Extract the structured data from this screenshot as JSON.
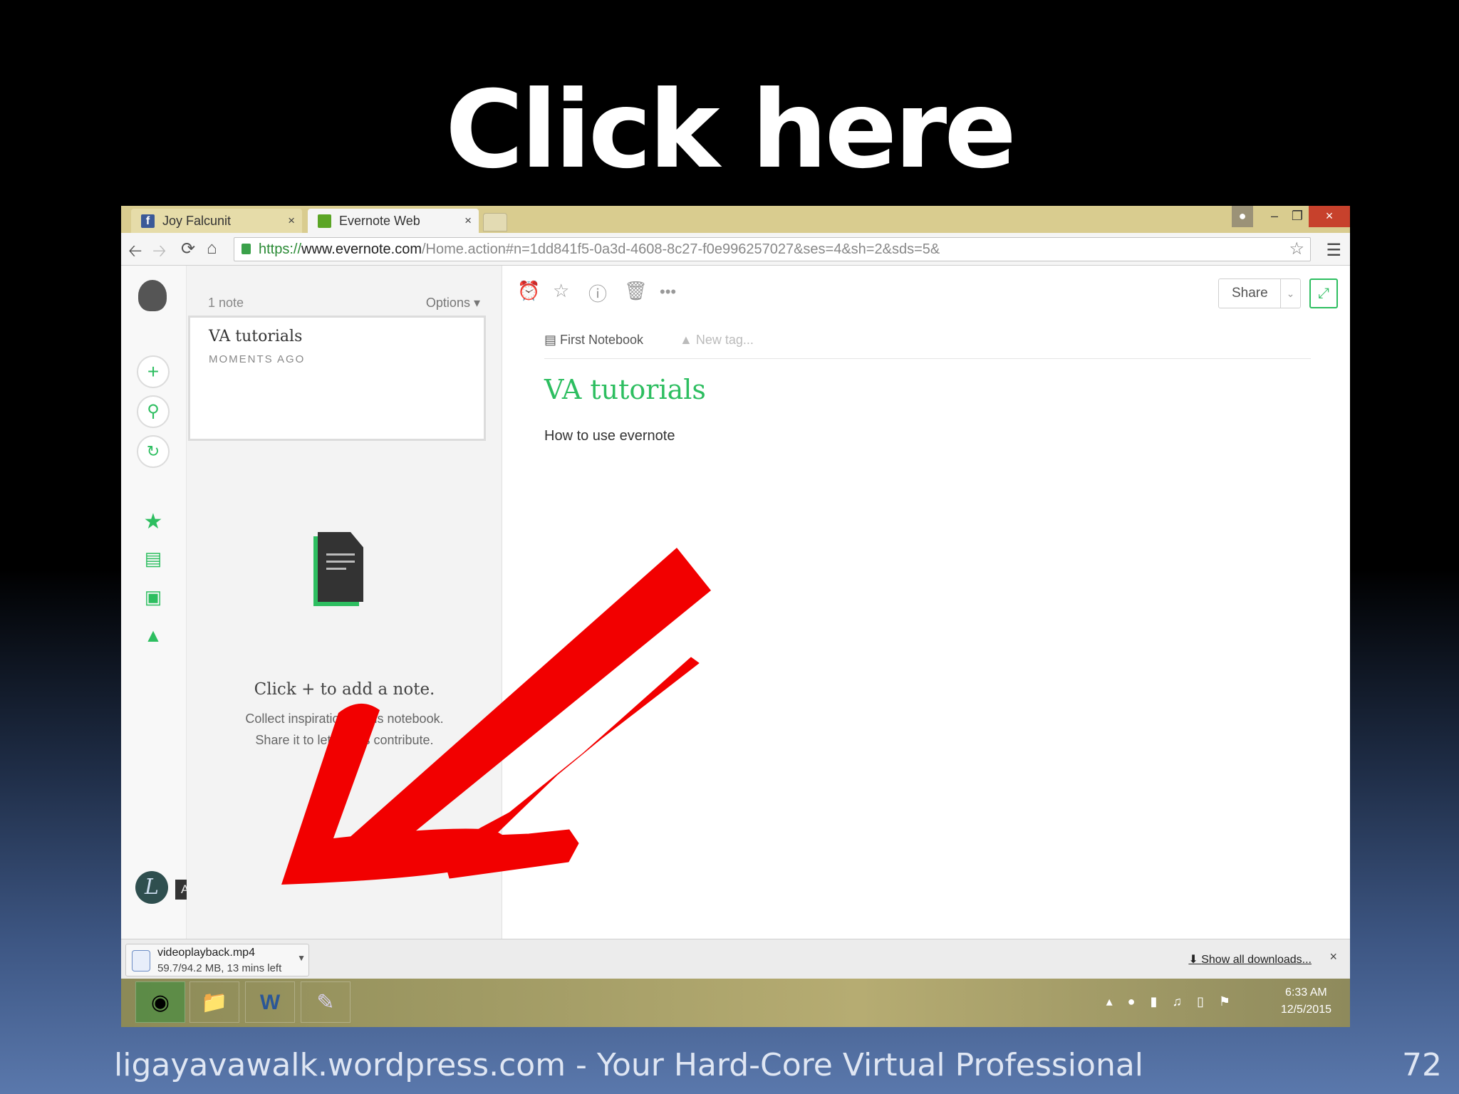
{
  "slide": {
    "title": "Click here",
    "footer": "ligayavawalk.wordpress.com - Your Hard-Core Virtual Professional",
    "page_number": "72"
  },
  "browser": {
    "tabs": [
      {
        "label": "Joy Falcunit",
        "favicon": "facebook-icon",
        "close": "×"
      },
      {
        "label": "Evernote Web",
        "favicon": "evernote-icon",
        "close": "×"
      }
    ],
    "address": {
      "scheme": "https://",
      "domain": "www.evernote.com",
      "path": "/Home.action#n=1dd841f5-0a3d-4608-8c27-f0e996257027&ses=4&sh=2&sds=5&"
    },
    "window_close": "×"
  },
  "evernote": {
    "note_count": "1 note",
    "options_label": "Options ▾",
    "note_card": {
      "title": "VA tutorials",
      "time": "MOMENTS AGO"
    },
    "empty_state": {
      "title": "Click + to add a note.",
      "line1": "Collect inspiration in this notebook.",
      "line2": "Share it to let others contribute."
    },
    "account_tooltip": "ACCOUNT",
    "editor": {
      "share_label": "Share",
      "notebook": "First Notebook",
      "new_tag_placeholder": "New tag...",
      "title": "VA tutorials",
      "body": "How to use evernote"
    },
    "accent_color": "#2dbe60"
  },
  "downloads": {
    "file_name": "videoplayback.mp4",
    "status": "59.7/94.2 MB, 13 mins left",
    "show_all": "Show all downloads...",
    "close": "×"
  },
  "taskbar": {
    "apps": [
      "chrome-icon",
      "file-explorer-icon",
      "word-icon",
      "paint-icon"
    ],
    "time": "6:33 AM",
    "date": "12/5/2015"
  },
  "annotation_color": "#ff0000"
}
